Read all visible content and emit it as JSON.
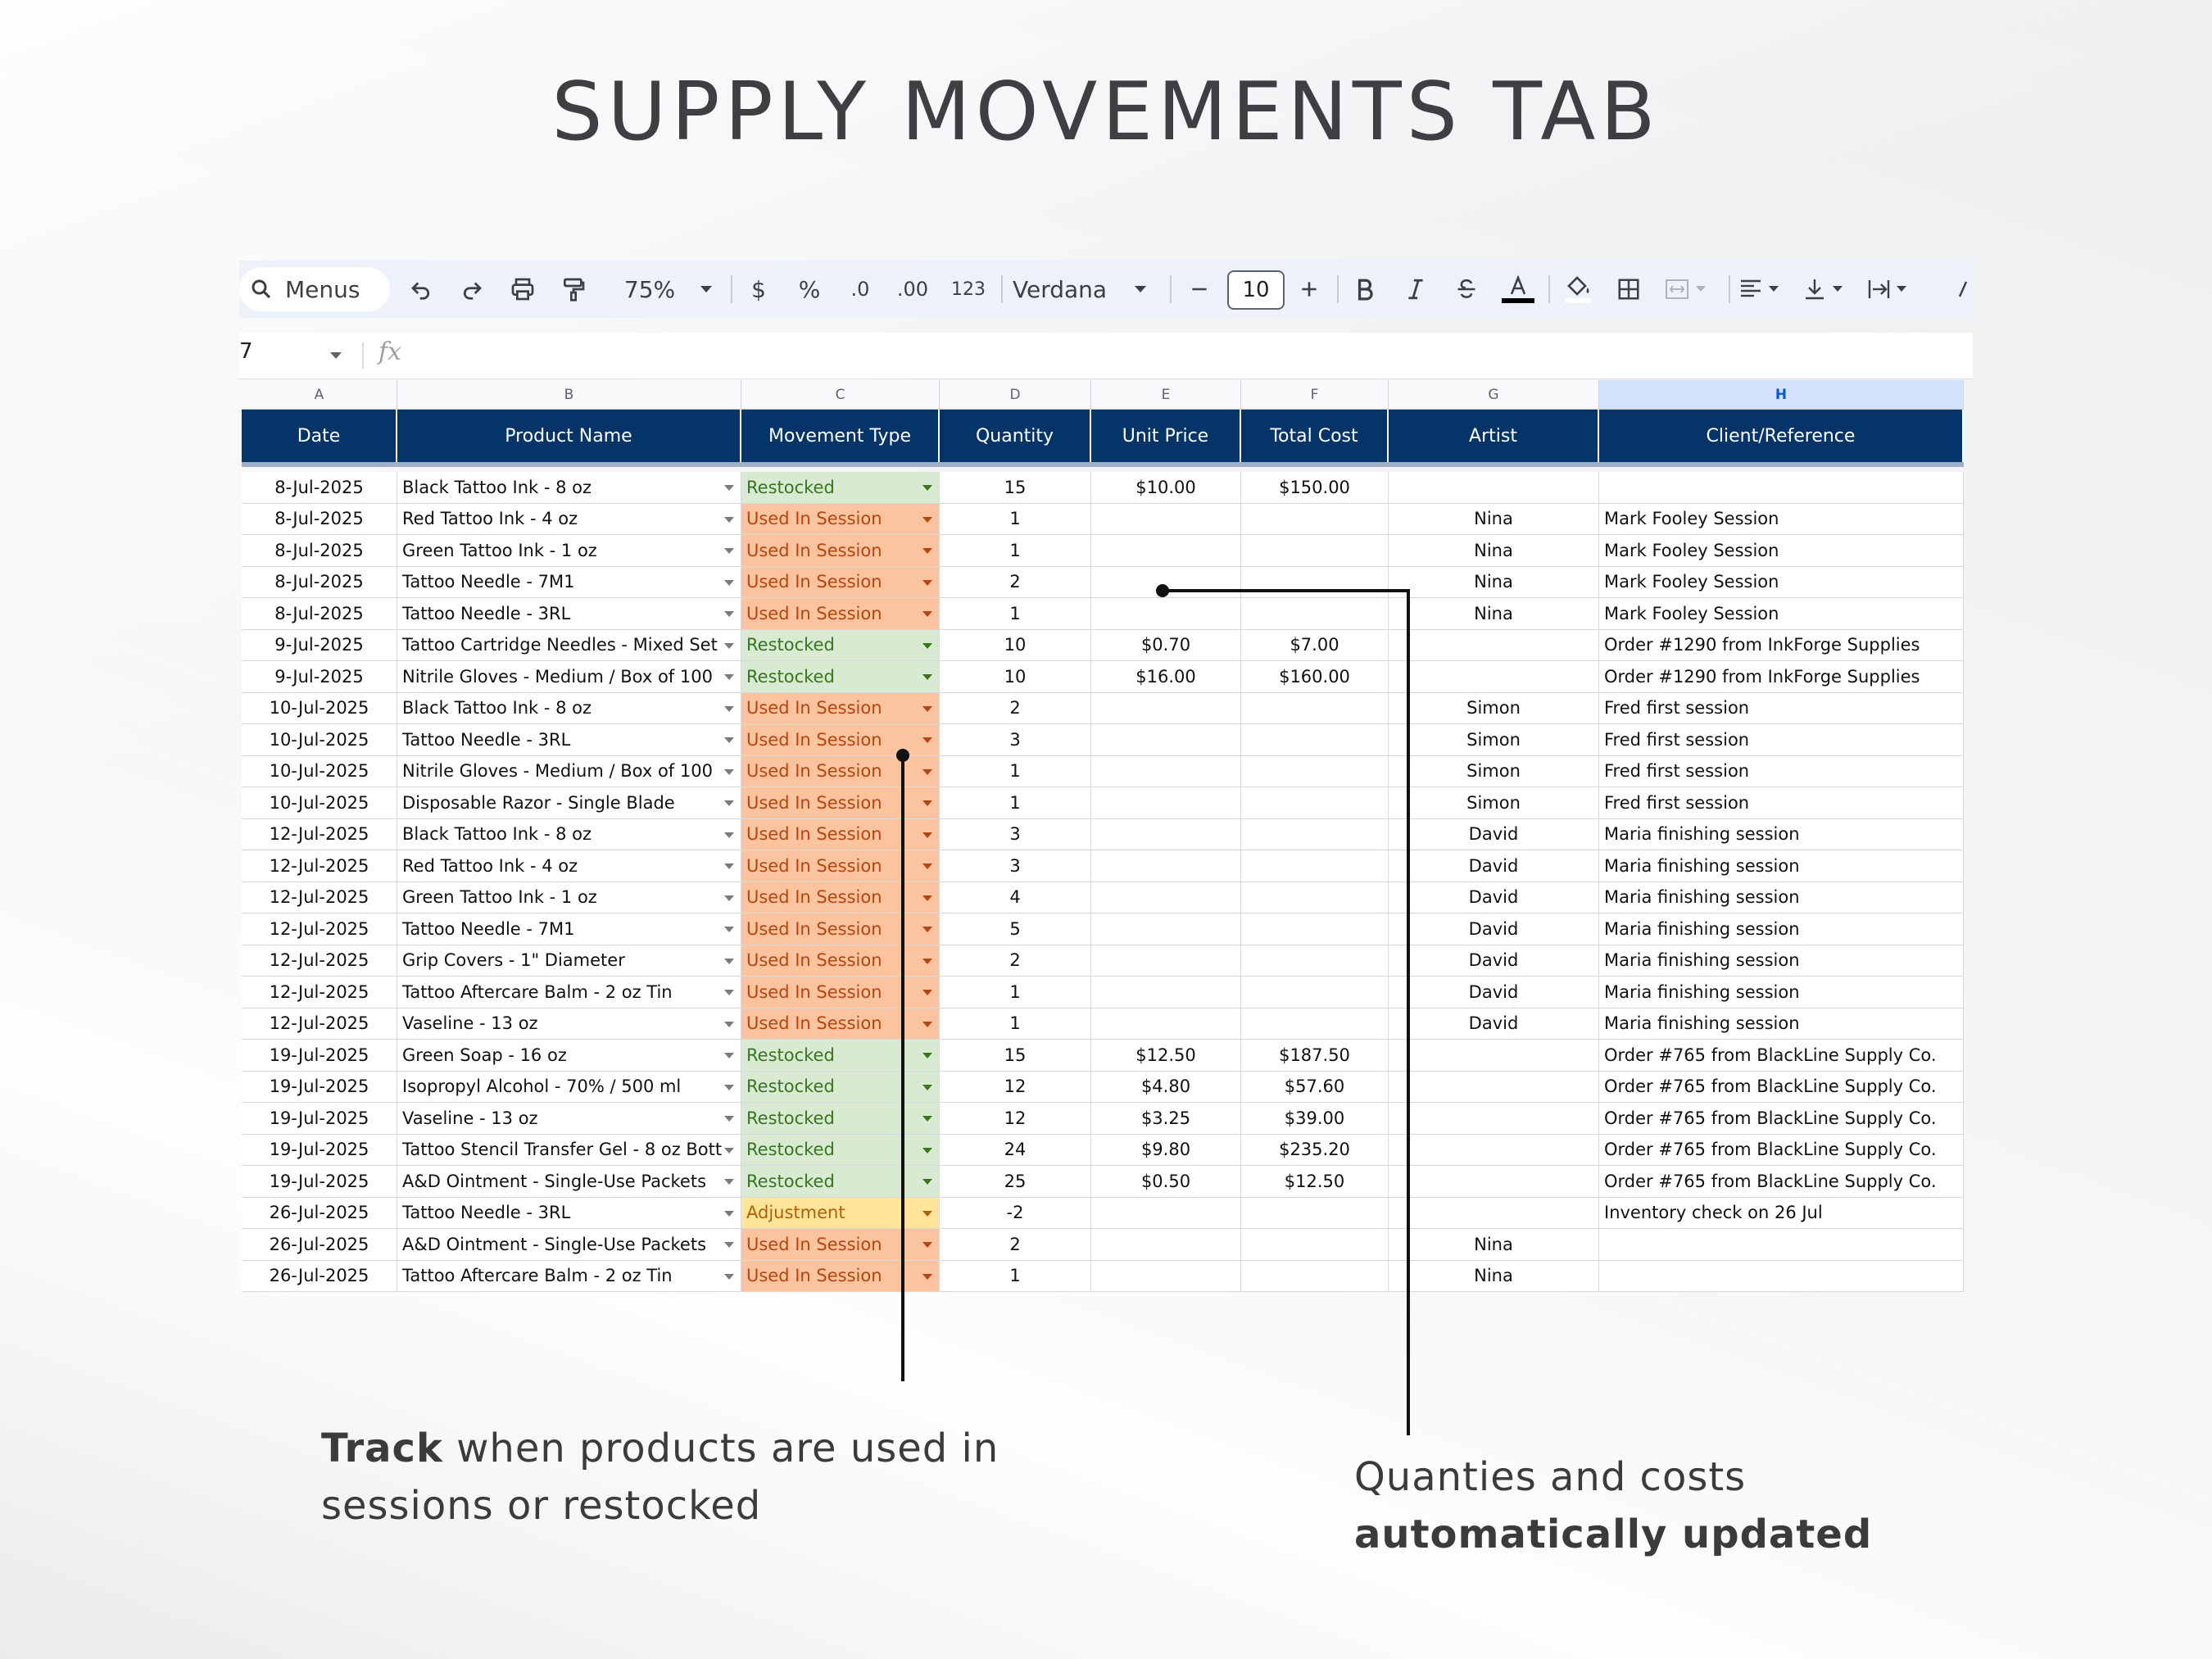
{
  "title": "SUPPLY MOVEMENTS TAB",
  "toolbar": {
    "menus_label": "Menus",
    "zoom": "75%",
    "currency": "$",
    "percent": "%",
    "decrease_decimals": ".0",
    "increase_decimals": ".00",
    "number_format": "123",
    "font": "Verdana",
    "font_size": "10"
  },
  "formula_bar": {
    "cell_ref": "7",
    "fx": "fx"
  },
  "columns": [
    "A",
    "B",
    "C",
    "D",
    "E",
    "F",
    "G",
    "H"
  ],
  "headers": [
    "Date",
    "Product Name",
    "Movement Type",
    "Quantity",
    "Unit Price",
    "Total Cost",
    "Artist",
    "Client/Reference"
  ],
  "rows": [
    [
      "8-Jul-2025",
      "Black Tattoo Ink  -  8 oz",
      "Restocked",
      "15",
      "$10.00",
      "$150.00",
      "",
      ""
    ],
    [
      "8-Jul-2025",
      "Red Tattoo Ink  -  4 oz",
      "Used In Session",
      "1",
      "",
      "",
      "Nina",
      "Mark Fooley Session"
    ],
    [
      "8-Jul-2025",
      "Green Tattoo Ink  -  1 oz",
      "Used In Session",
      "1",
      "",
      "",
      "Nina",
      "Mark Fooley Session"
    ],
    [
      "8-Jul-2025",
      "Tattoo Needle - 7M1",
      "Used In Session",
      "2",
      "",
      "",
      "Nina",
      "Mark Fooley Session"
    ],
    [
      "8-Jul-2025",
      "Tattoo Needle - 3RL",
      "Used In Session",
      "1",
      "",
      "",
      "Nina",
      "Mark Fooley Session"
    ],
    [
      "9-Jul-2025",
      "Tattoo Cartridge Needles  -  Mixed Set",
      "Restocked",
      "10",
      "$0.70",
      "$7.00",
      "",
      "Order #1290 from InkForge Supplies"
    ],
    [
      "9-Jul-2025",
      "Nitrile Gloves  -  Medium / Box of 100",
      "Restocked",
      "10",
      "$16.00",
      "$160.00",
      "",
      "Order #1290 from InkForge Supplies"
    ],
    [
      "10-Jul-2025",
      "Black Tattoo Ink  -  8 oz",
      "Used In Session",
      "2",
      "",
      "",
      "Simon",
      "Fred first session"
    ],
    [
      "10-Jul-2025",
      "Tattoo Needle - 3RL",
      "Used In Session",
      "3",
      "",
      "",
      "Simon",
      "Fred first session"
    ],
    [
      "10-Jul-2025",
      "Nitrile Gloves  -  Medium / Box of 100",
      "Used In Session",
      "1",
      "",
      "",
      "Simon",
      "Fred first session"
    ],
    [
      "10-Jul-2025",
      "Disposable Razor  -  Single Blade",
      "Used In Session",
      "1",
      "",
      "",
      "Simon",
      "Fred first session"
    ],
    [
      "12-Jul-2025",
      "Black Tattoo Ink  -  8 oz",
      "Used In Session",
      "3",
      "",
      "",
      "David",
      "Maria finishing session"
    ],
    [
      "12-Jul-2025",
      "Red Tattoo Ink  -  4 oz",
      "Used In Session",
      "3",
      "",
      "",
      "David",
      "Maria finishing session"
    ],
    [
      "12-Jul-2025",
      "Green Tattoo Ink  -  1 oz",
      "Used In Session",
      "4",
      "",
      "",
      "David",
      "Maria finishing session"
    ],
    [
      "12-Jul-2025",
      "Tattoo Needle - 7M1",
      "Used In Session",
      "5",
      "",
      "",
      "David",
      "Maria finishing session"
    ],
    [
      "12-Jul-2025",
      "Grip Covers  -  1\" Diameter",
      "Used In Session",
      "2",
      "",
      "",
      "David",
      "Maria finishing session"
    ],
    [
      "12-Jul-2025",
      "Tattoo Aftercare Balm  -  2 oz Tin",
      "Used In Session",
      "1",
      "",
      "",
      "David",
      "Maria finishing session"
    ],
    [
      "12-Jul-2025",
      "Vaseline  -  13 oz",
      "Used In Session",
      "1",
      "",
      "",
      "David",
      "Maria finishing session"
    ],
    [
      "19-Jul-2025",
      "Green Soap  -  16 oz",
      "Restocked",
      "15",
      "$12.50",
      "$187.50",
      "",
      "Order #765 from BlackLine Supply Co."
    ],
    [
      "19-Jul-2025",
      "Isopropyl Alcohol  -  70% / 500 ml",
      "Restocked",
      "12",
      "$4.80",
      "$57.60",
      "",
      "Order #765 from BlackLine Supply Co."
    ],
    [
      "19-Jul-2025",
      "Vaseline  -  13 oz",
      "Restocked",
      "12",
      "$3.25",
      "$39.00",
      "",
      "Order #765 from BlackLine Supply Co."
    ],
    [
      "19-Jul-2025",
      "Tattoo Stencil Transfer Gel  -  8 oz Bott",
      "Restocked",
      "24",
      "$9.80",
      "$235.20",
      "",
      "Order #765 from BlackLine Supply Co."
    ],
    [
      "19-Jul-2025",
      "A&D Ointment  -  Single-Use Packets",
      "Restocked",
      "25",
      "$0.50",
      "$12.50",
      "",
      "Order #765 from BlackLine Supply Co."
    ],
    [
      "26-Jul-2025",
      "Tattoo Needle - 3RL",
      "Adjustment",
      "-2",
      "",
      "",
      "",
      "Inventory check on 26 Jul"
    ],
    [
      "26-Jul-2025",
      "A&D Ointment  -  Single-Use Packets",
      "Used In Session",
      "2",
      "",
      "",
      "Nina",
      ""
    ],
    [
      "26-Jul-2025",
      "Tattoo Aftercare Balm  -  2 oz Tin",
      "Used In Session",
      "1",
      "",
      "",
      "Nina",
      ""
    ]
  ],
  "captions": {
    "left_bold": "Track",
    "left_rest_line1": " when products are used in",
    "left_line2": "sessions or restocked",
    "right_line1": "Quanties and costs",
    "right_bold": "automatically updated"
  },
  "colors": {
    "header_bg": "#053468",
    "restocked_bg": "#d9ead3",
    "used_bg": "#fcc39f",
    "adjustment_bg": "#ffe599"
  }
}
